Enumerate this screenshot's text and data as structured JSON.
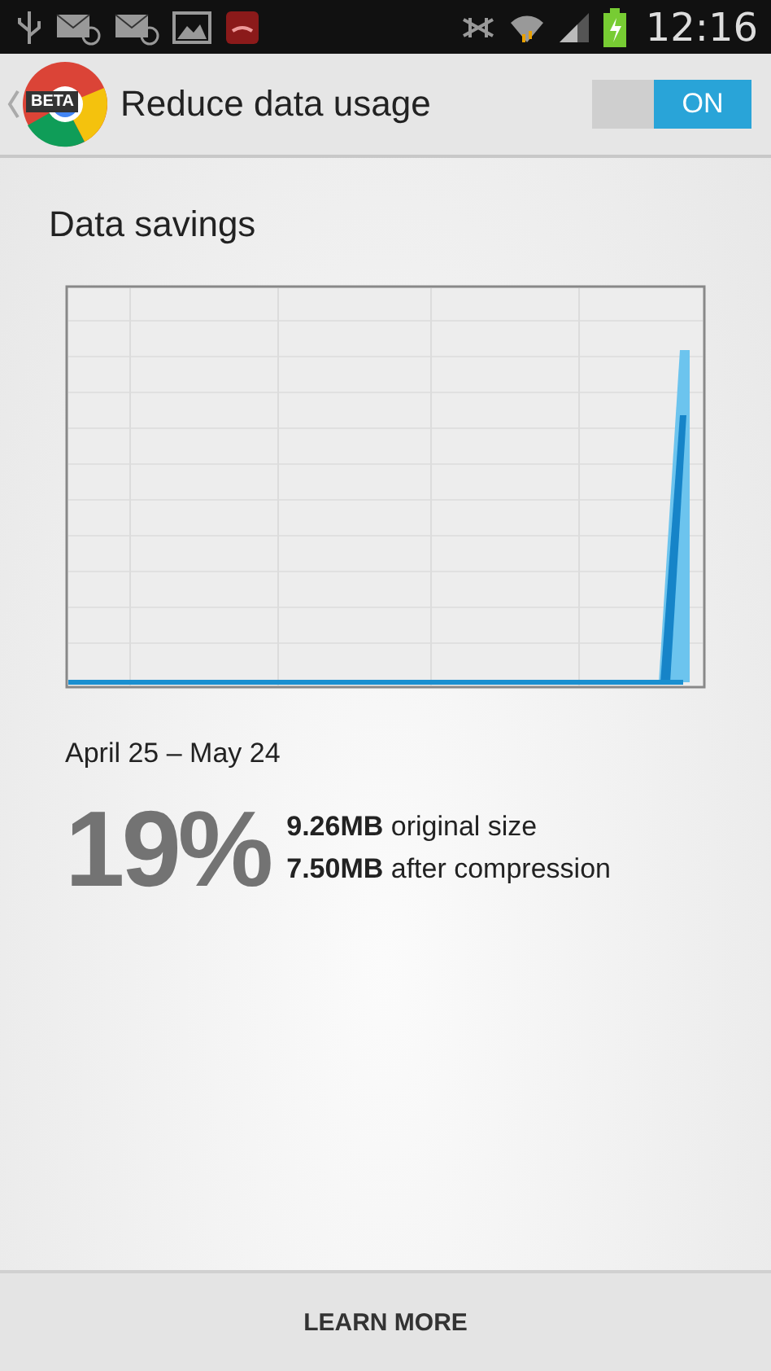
{
  "status_bar": {
    "time": "12:16"
  },
  "action_bar": {
    "logo_badge": "BETA",
    "title": "Reduce data usage",
    "toggle": {
      "label": "ON",
      "on": true
    }
  },
  "section_title": "Data savings",
  "date_range": "April 25 – May 24",
  "savings": {
    "percent": "19%",
    "lines": [
      "**9.26MB** original size",
      "**7.50MB** after compression"
    ]
  },
  "footer_button": "LEARN MORE"
}
